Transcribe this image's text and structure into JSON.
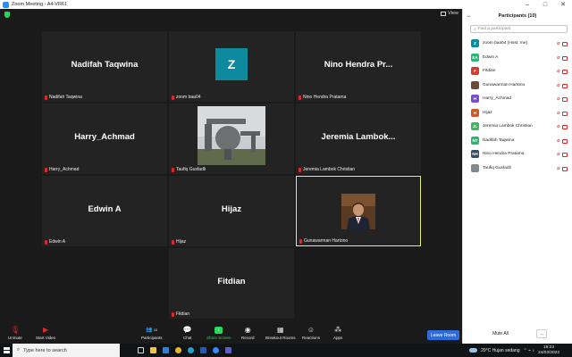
{
  "window": {
    "title": "Zoom Meeting - A4-VR61",
    "min": "–",
    "max": "□",
    "close": "✕"
  },
  "meeting": {
    "view_label": "View",
    "tiles": [
      {
        "big": "Nadifah Taqwina",
        "label": "Nadifah Taqwina"
      },
      {
        "avatar": "Z",
        "label": "zoom baa04"
      },
      {
        "big": "Nino Hendra Pr...",
        "label": "Nino Hendra Pratama"
      },
      {
        "big": "Harry_Achmad",
        "label": "Harry_Achmad"
      },
      {
        "label": "Taufiq Gusfadli"
      },
      {
        "big": "Jeremia  Lambok...",
        "label": "Jeremia Lambok Christian"
      },
      {
        "big": "Edwin A",
        "label": "Edwin A"
      },
      {
        "big": "Hijaz",
        "label": "Hijaz"
      },
      {
        "label": "Gunawarman Hartono"
      },
      {
        "big": "Fitdian",
        "label": "Fitdian"
      }
    ]
  },
  "toolbar": {
    "unmute": "Unmute",
    "start_video": "Start Video",
    "participants": "Participants",
    "participants_count": "10",
    "chat": "Chat",
    "share_screen": "Share Screen",
    "record": "Record",
    "breakout_rooms": "Breakout Rooms",
    "reactions": "Reactions",
    "apps": "Apps",
    "leave": "Leave Room"
  },
  "panel": {
    "title": "Participants (10)",
    "search_placeholder": "Find a participant",
    "participants": [
      {
        "initials": "Z",
        "name": "zoom baa04 (Host, me)",
        "color": "#0e8a9e"
      },
      {
        "initials": "EA",
        "name": "Edwin A",
        "color": "#2bb673"
      },
      {
        "initials": "F",
        "name": "Fitdian",
        "color": "#d93a2b"
      },
      {
        "initials": "",
        "name": "Gunawarman Hartono",
        "color": "#6b4a3a"
      },
      {
        "initials": "H",
        "name": "Harry_Achmad",
        "color": "#7b4fd0"
      },
      {
        "initials": "H",
        "name": "Hijaz",
        "color": "#d0582b"
      },
      {
        "initials": "JL",
        "name": "Jeremia Lambok Christian",
        "color": "#3db85f"
      },
      {
        "initials": "NT",
        "name": "Nadifah Taqwina",
        "color": "#2bb673"
      },
      {
        "initials": "NH",
        "name": "Nino Hendra Pratama",
        "color": "#3a4a60"
      },
      {
        "initials": "",
        "name": "Taufiq Gusfadli",
        "color": "#7f8a8c"
      }
    ],
    "mute_all": "Mute All",
    "more": "..."
  },
  "taskbar": {
    "search": "Type here to search",
    "weather": "29°C  Hujan sedang",
    "time": "19:23",
    "date": "24/03/2022"
  }
}
